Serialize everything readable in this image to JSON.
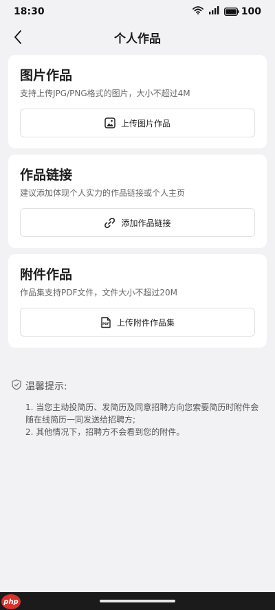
{
  "status_bar": {
    "time": "18:30",
    "battery": "100"
  },
  "nav": {
    "title": "个人作品"
  },
  "cards": [
    {
      "title": "图片作品",
      "desc": "支持上传JPG/PNG格式的图片，大小不超过4M",
      "button": "上传图片作品",
      "icon": "image-icon"
    },
    {
      "title": "作品链接",
      "desc": "建议添加体现个人实力的作品链接或个人主页",
      "button": "添加作品链接",
      "icon": "link-icon"
    },
    {
      "title": "附件作品",
      "desc": "作品集支持PDF文件，文件大小不超过20M",
      "button": "上传附件作品集",
      "icon": "pdf-file-icon"
    }
  ],
  "tips": {
    "title": "温馨提示:",
    "items": [
      "1. 当您主动投简历、发简历及同意招聘方向您索要简历时附件会随在线简历一同发送给招聘方;",
      "2. 其他情况下，招聘方不会看到您的附件。"
    ]
  },
  "watermark": "php"
}
